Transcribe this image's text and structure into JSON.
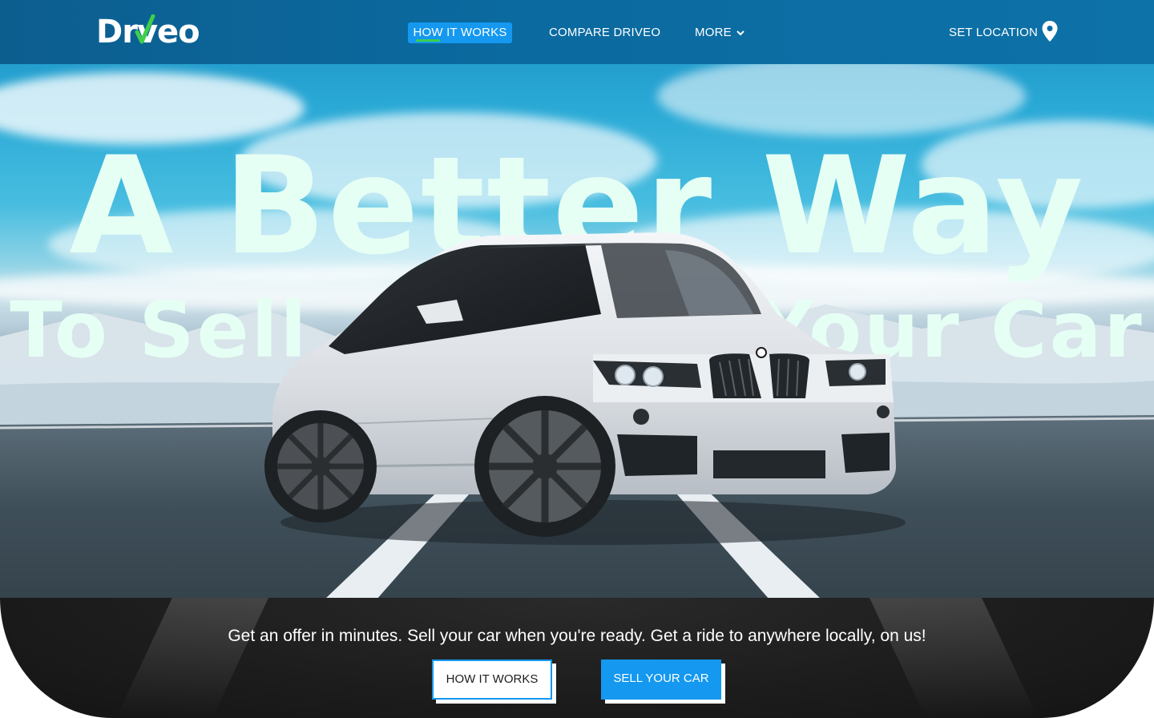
{
  "brand": {
    "logo_text": "Driveo",
    "logo_part1": "Dr",
    "logo_part2": "veo"
  },
  "nav": {
    "items": [
      {
        "label": "HOW IT WORKS",
        "active": true
      },
      {
        "label": "COMPARE DRIVEO",
        "active": false
      },
      {
        "label": "MORE",
        "active": false
      }
    ],
    "location_label": "SET LOCATION"
  },
  "hero": {
    "headline_line1": "A Better Way",
    "headline_line2_left": "To Sell",
    "headline_line2_right": "Your Car"
  },
  "cta": {
    "tagline": "Get an offer in minutes. Sell your car when you're ready. Get a ride to anywhere locally, on us!",
    "secondary_button": "HOW IT WORKS",
    "primary_button": "SELL YOUR CAR"
  },
  "icons": {
    "location": "map-pin-icon",
    "more_dropdown": "chevron-down-icon",
    "logo_mark": "check-icon"
  },
  "colors": {
    "nav_bg": "#0b6aa0",
    "accent_blue": "#1498f0",
    "accent_green": "#3ecf4a",
    "headline": "#e6fff4",
    "panel_dark": "#1c1c1c"
  }
}
